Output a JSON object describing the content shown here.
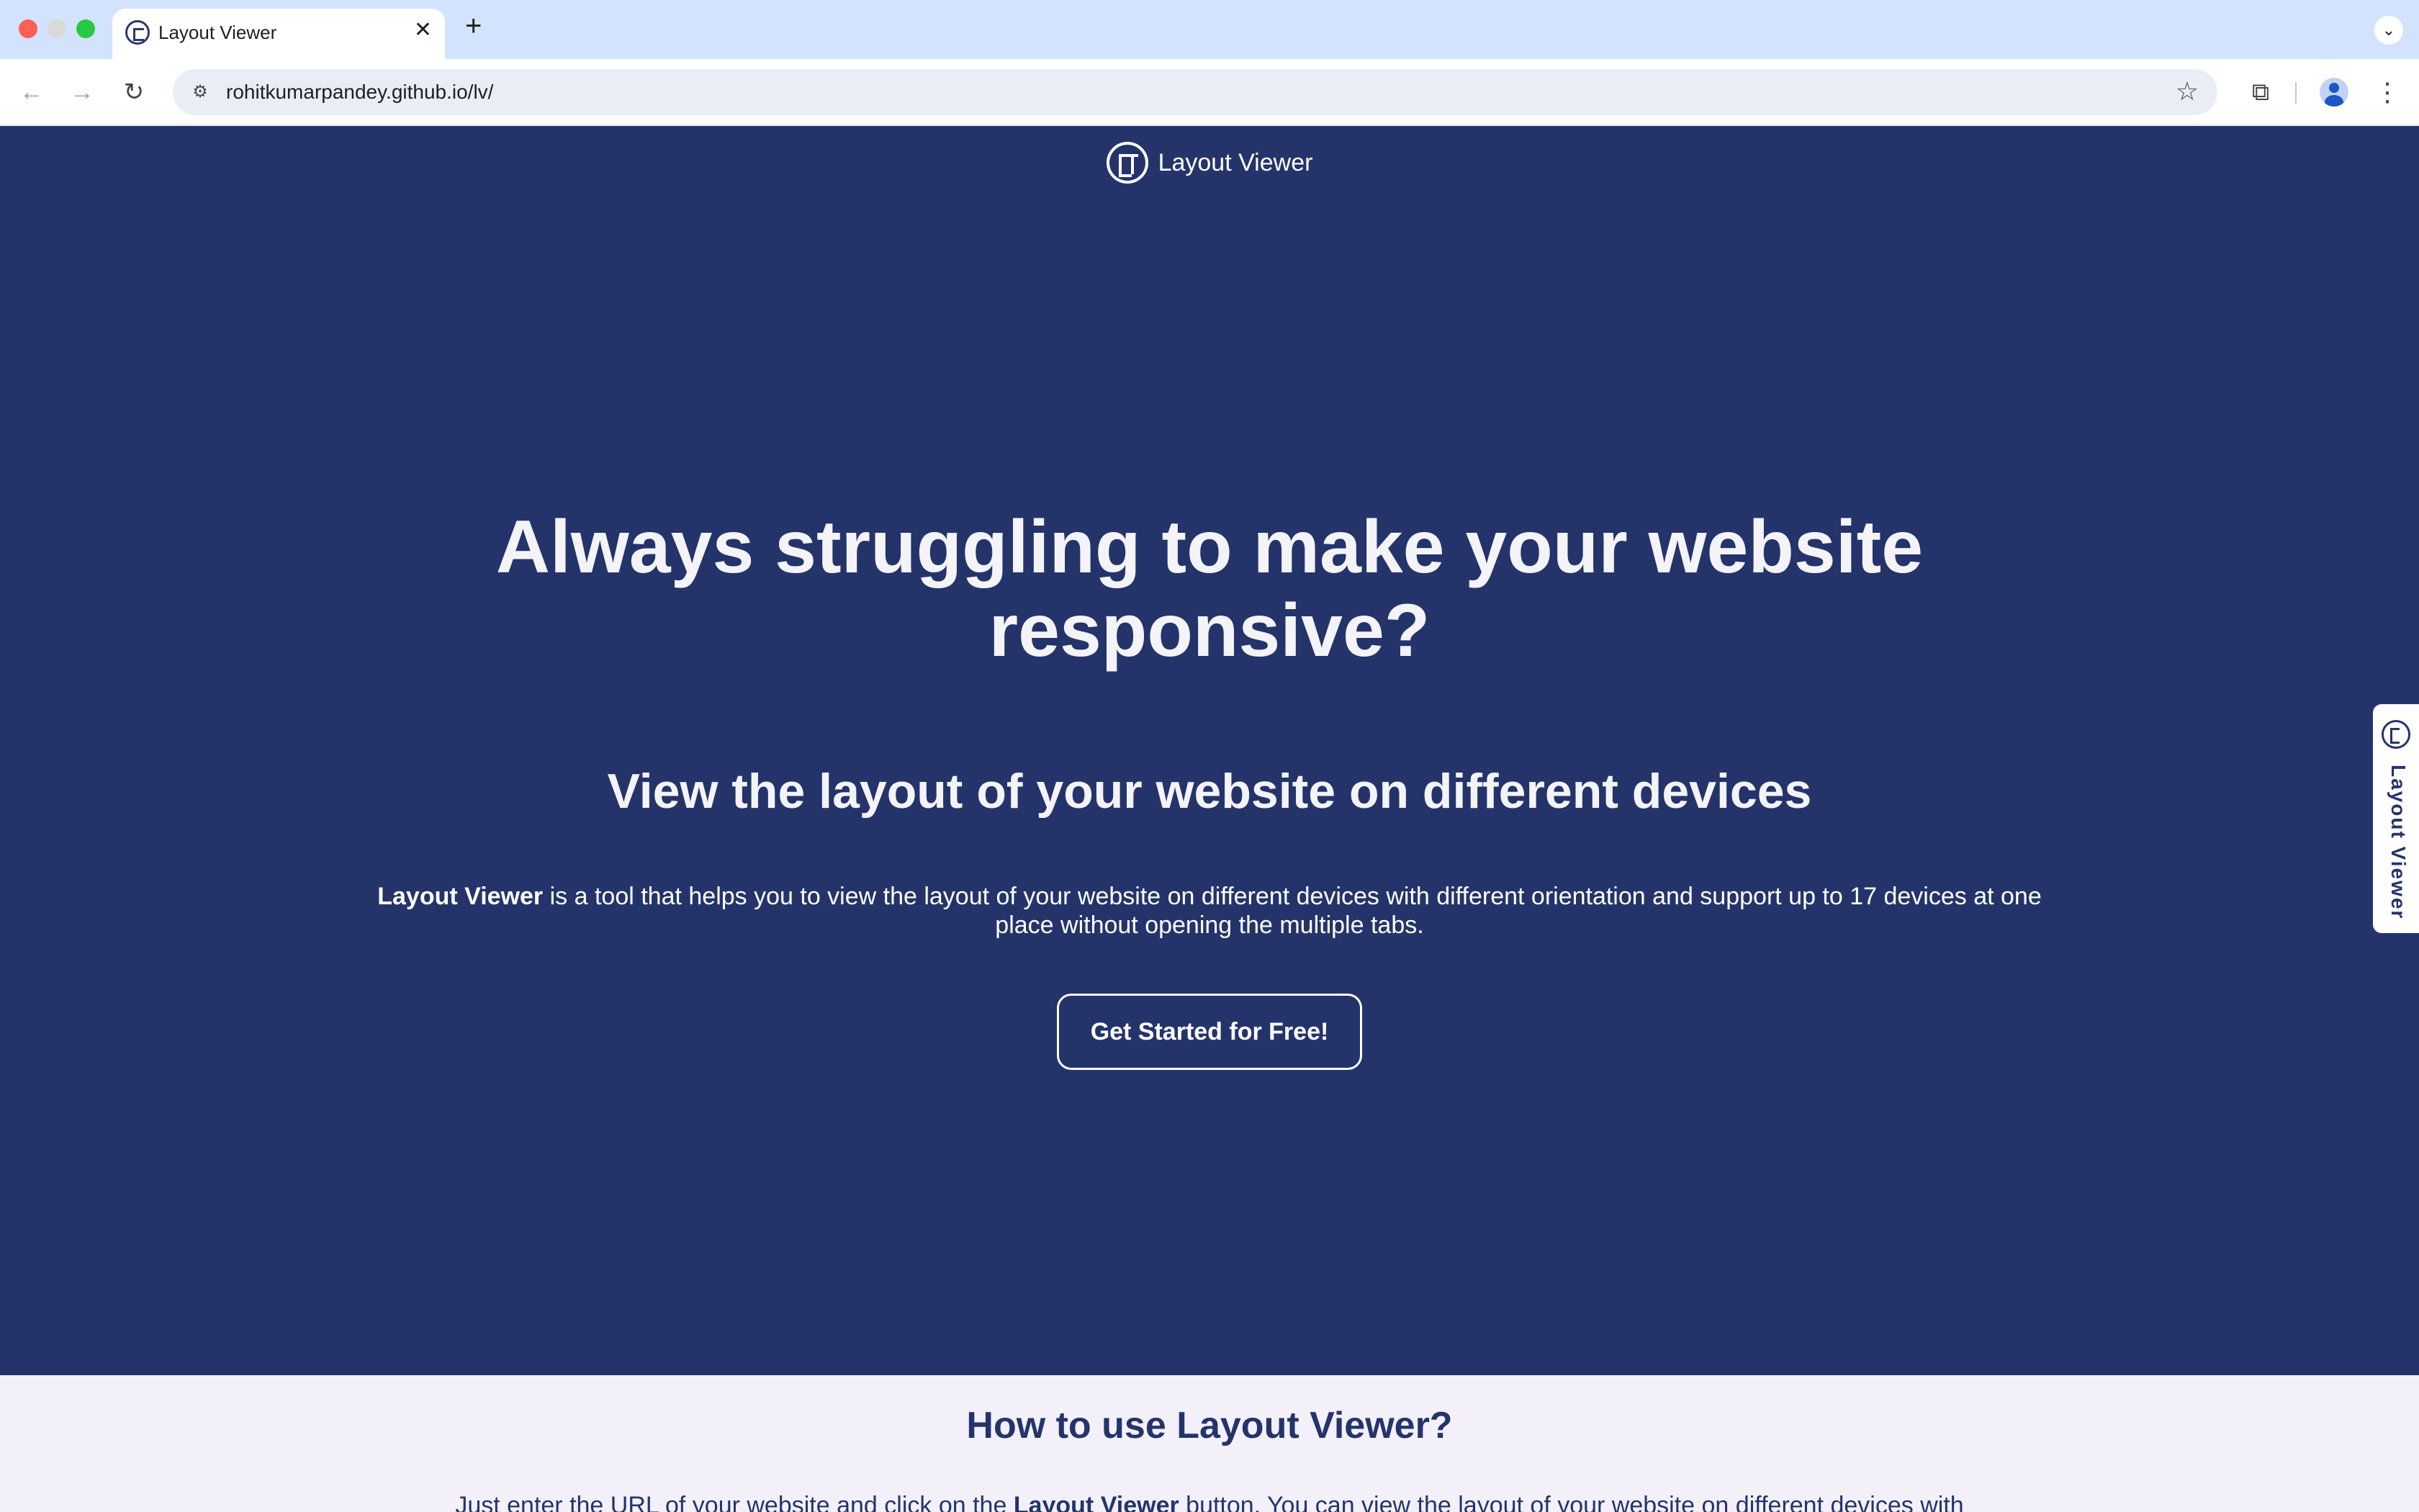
{
  "browser": {
    "tab_title": "Layout Viewer",
    "tab_close": "✕",
    "new_tab": "+",
    "url": "rohitkumarpandey.github.io/lv/"
  },
  "icons": {
    "back": "back-arrow-icon",
    "forward": "forward-arrow-icon",
    "reload": "reload-icon",
    "site_info": "site-info-icon",
    "star": "star-icon",
    "extensions": "puzzle-icon",
    "profile": "profile-icon",
    "menu": "kebab-menu-icon",
    "tab_search": "chevron-down-icon"
  },
  "header": {
    "brand": "Layout Viewer"
  },
  "hero": {
    "headline_line1": "Always struggling to make your website",
    "headline_line2": "responsive?",
    "subheadline": "View the layout of your website on different devices",
    "desc_bold": "Layout Viewer",
    "desc_rest": " is a tool that helps you to view the layout of your website on different devices with different orientation and support up to 17 devices at one place without opening the multiple tabs.",
    "cta": "Get Started for Free!"
  },
  "side_tab": {
    "label": "Layout Viewer"
  },
  "howto": {
    "title": "How to use Layout Viewer?",
    "text_start": "Just enter the URL of your website and click on the ",
    "text_bold": "Layout Viewer",
    "text_end": " button. You can view the layout of your website on different devices with"
  },
  "colors": {
    "hero_bg": "#24346b",
    "section_bg": "#f3f0fa",
    "tabbar_bg": "#d3e3fd"
  }
}
